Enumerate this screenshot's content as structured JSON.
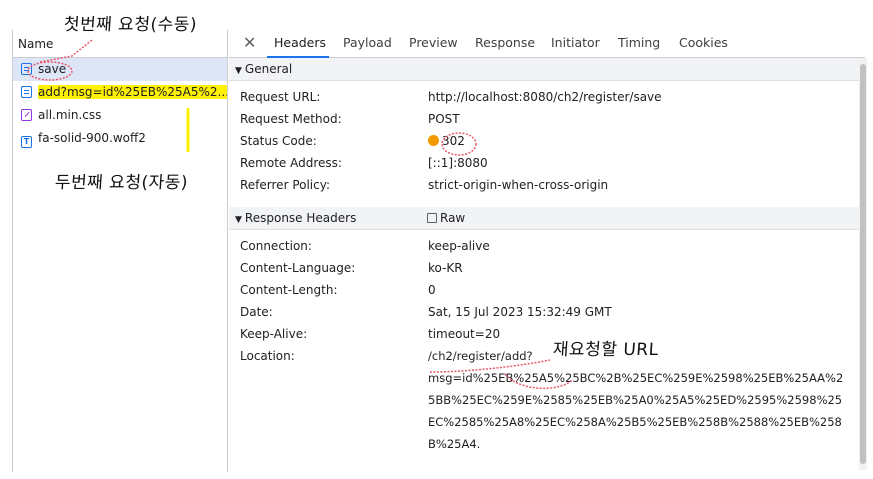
{
  "request_list": {
    "column_header": "Name",
    "items": [
      {
        "name": "save",
        "type": "doc"
      },
      {
        "name": "add?msg=id%25EB%25A5%2...",
        "type": "doc"
      },
      {
        "name": "all.min.css",
        "type": "css"
      },
      {
        "name": "fa-solid-900.woff2",
        "type": "font"
      }
    ],
    "selected_index": 0
  },
  "tabs": [
    "Headers",
    "Payload",
    "Preview",
    "Response",
    "Initiator",
    "Timing",
    "Cookies"
  ],
  "active_tab": "Headers",
  "general": {
    "title": "General",
    "rows": [
      {
        "key": "Request URL:",
        "value": "http://localhost:8080/ch2/register/save"
      },
      {
        "key": "Request Method:",
        "value": "POST"
      },
      {
        "key": "Status Code:",
        "value": "302"
      },
      {
        "key": "Remote Address:",
        "value": "[::1]:8080"
      },
      {
        "key": "Referrer Policy:",
        "value": "strict-origin-when-cross-origin"
      }
    ]
  },
  "response_headers": {
    "title": "Response Headers",
    "raw_label": "Raw",
    "rows": [
      {
        "key": "Connection:",
        "value": "keep-alive"
      },
      {
        "key": "Content-Language:",
        "value": "ko-KR"
      },
      {
        "key": "Content-Length:",
        "value": "0"
      },
      {
        "key": "Date:",
        "value": "Sat, 15 Jul 2023 15:32:49 GMT"
      },
      {
        "key": "Keep-Alive:",
        "value": "timeout=20"
      }
    ],
    "location_key": "Location:",
    "location_lines": [
      "/ch2/register/add?",
      "msg=id%25EB%25A5%25BC%2B%25EC%259E%2598%25EB%25AA%2",
      "5BB%25EC%259E%2585%25EB%25A0%25A5%25ED%2595%2598%25",
      "EC%2585%25A8%25EC%258A%25B5%25EB%258B%2588%25EB%258",
      "B%25A4."
    ]
  },
  "annotations": {
    "first_request": "첫번째 요청(수동)",
    "second_request": "두번째 요청(자동)",
    "redirect_url": "재요청할 URL"
  },
  "colors": {
    "status_dot": "#f29900",
    "highlight": "#fff200",
    "accent": "#1a73e8",
    "circle": "#e8586a"
  }
}
